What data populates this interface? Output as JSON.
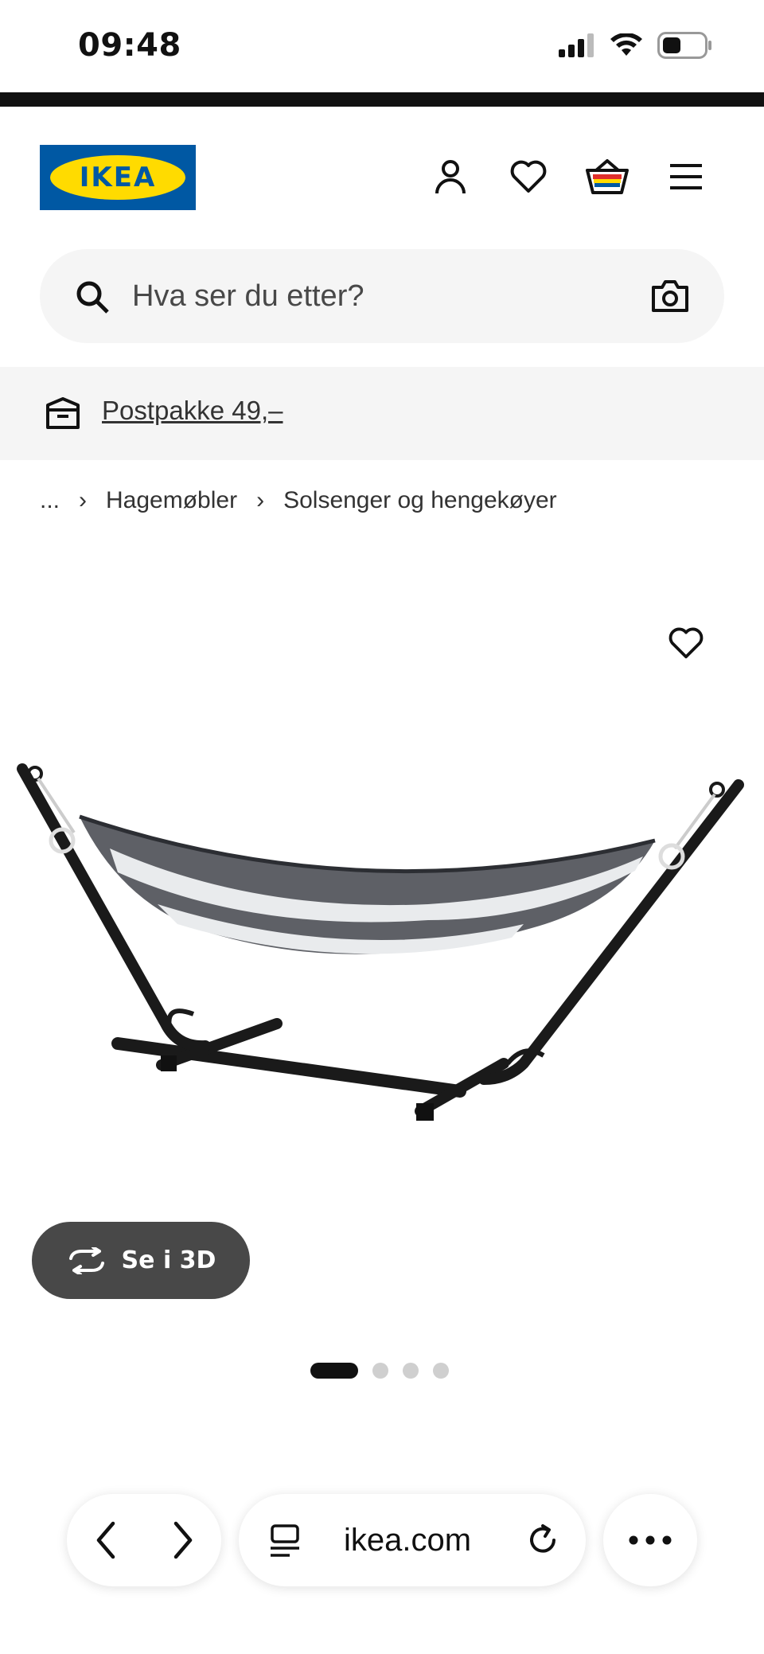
{
  "status": {
    "time": "09:48"
  },
  "header": {
    "logo_text": "IKEA"
  },
  "search": {
    "placeholder": "Hva ser du etter?"
  },
  "shipping": {
    "label": "Postpakke 49,–"
  },
  "breadcrumb": {
    "items": [
      "...",
      "Hagemøbler",
      "Solsenger og hengekøyer"
    ]
  },
  "product": {
    "view_3d_label": "Se i 3D",
    "image_count": 4,
    "active_image": 1
  },
  "browser": {
    "url": "ikea.com"
  },
  "colors": {
    "ikea_blue": "#0058a3",
    "ikea_yellow": "#ffdb00",
    "dark_button": "#484848"
  }
}
